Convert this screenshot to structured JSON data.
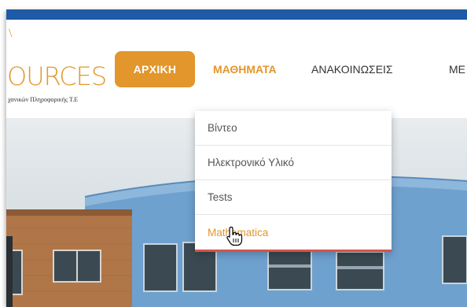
{
  "logo": {
    "mark": "\\",
    "text": "OURCES",
    "subtitle": "χανικών Πληροφορικής Τ.Ε"
  },
  "nav": {
    "home": "ΑΡΧΙΚΗ",
    "courses": "ΜΑΘΗΜΑΤΑ",
    "announcements": "ΑΝΑΚΟΙΝΩΣΕΙΣ",
    "more": "ΜΕ"
  },
  "dropdown": {
    "items": [
      "Βίντεο",
      "Ηλεκτρονικό Υλικό",
      "Tests",
      "Mathematica"
    ],
    "hovered_index": 3
  },
  "colors": {
    "topbar": "#1f5aa6",
    "accent": "#e2962c",
    "dropdown_border": "#d5544a",
    "building_blue": "#6fa1cf",
    "brick": "#b07648"
  },
  "icons": {
    "cursor": "hand-pointer-icon"
  }
}
